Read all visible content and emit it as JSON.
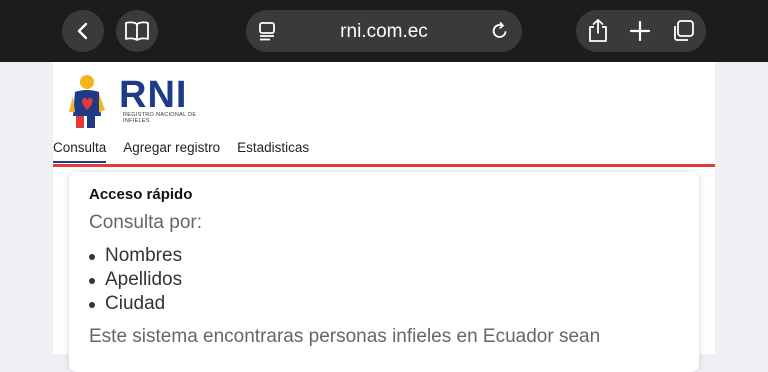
{
  "browser": {
    "url": "rni.com.ec",
    "icons": [
      "back-icon",
      "bookmarks-icon",
      "page-menu-icon",
      "reload-icon",
      "share-icon",
      "new-tab-icon",
      "tabs-icon"
    ]
  },
  "site": {
    "brand": "RNI",
    "brand_subtitle": "REGISTRO NACIONAL DE INFIELES",
    "nav": [
      {
        "label": "Consulta",
        "active": true
      },
      {
        "label": "Agregar registro",
        "active": false
      },
      {
        "label": "Estadisticas",
        "active": false
      }
    ],
    "accent_color": "#e23a3a",
    "brand_color": "#1f3a86"
  },
  "card": {
    "title": "Acceso rápido",
    "subtitle": "Consulta por:",
    "items": [
      "Nombres",
      "Apellidos",
      "Ciudad"
    ],
    "description": "Este sistema encontraras personas infieles en Ecuador sean"
  }
}
